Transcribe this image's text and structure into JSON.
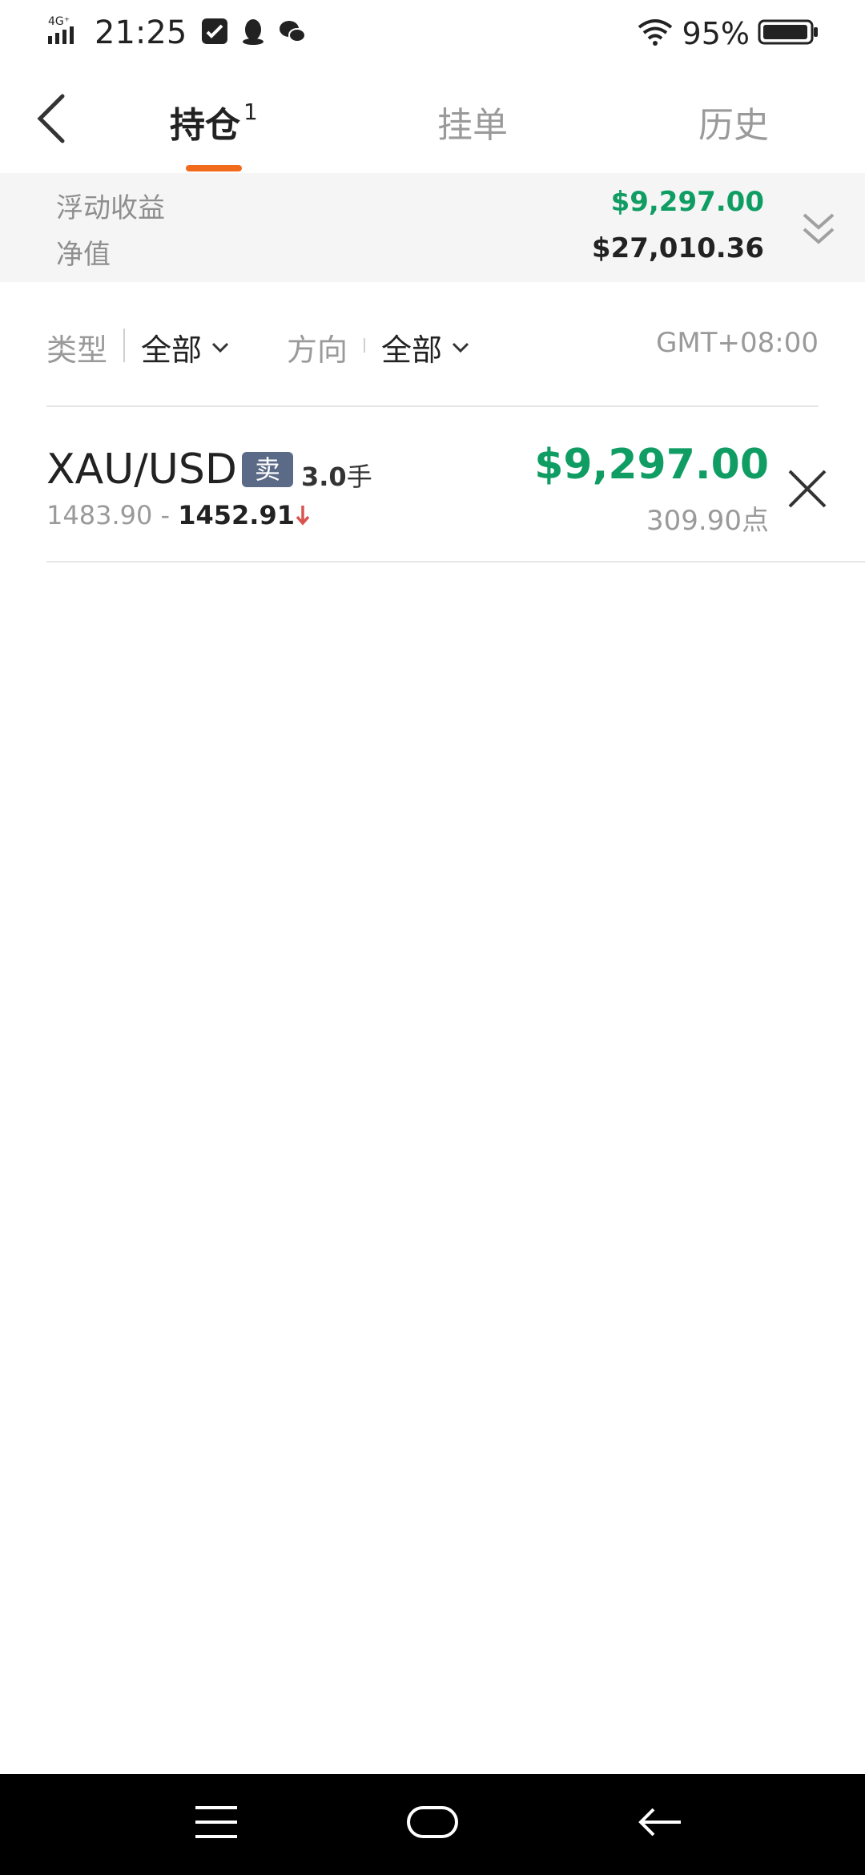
{
  "status_bar": {
    "network": "4G⁺",
    "time": "21:25",
    "battery_text": "95%"
  },
  "header": {
    "tabs": [
      {
        "label": "持仓",
        "badge": "1"
      },
      {
        "label": "挂单"
      },
      {
        "label": "历史"
      }
    ]
  },
  "summary": {
    "floating_pnl_label": "浮动收益",
    "floating_pnl_value": "$9,297.00",
    "equity_label": "净值",
    "equity_value": "$27,010.36"
  },
  "filters": {
    "type_label": "类型",
    "type_value": "全部",
    "direction_label": "方向",
    "direction_value": "全部",
    "timezone": "GMT+08:00"
  },
  "positions": [
    {
      "symbol": "XAU/USD",
      "side": "卖",
      "lots": "3.0",
      "lots_unit": "手",
      "open_price": "1483.90",
      "separator": "-",
      "current_price": "1452.91",
      "pnl": "$9,297.00",
      "points": "309.90点"
    }
  ],
  "colors": {
    "accent": "#f26b1d",
    "profit": "#0f9d63",
    "badge_sell": "#5b6a86",
    "down_arrow": "#d9534f"
  }
}
